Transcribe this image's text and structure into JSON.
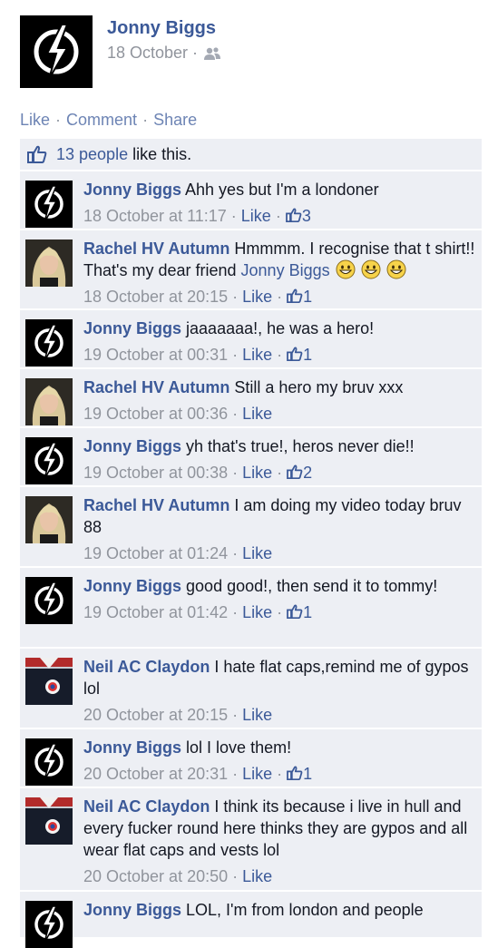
{
  "post": {
    "author": "Jonny Biggs",
    "date": "18 October ·",
    "audience_icon": "friends-icon"
  },
  "actions": {
    "like": "Like",
    "comment": "Comment",
    "share": "Share",
    "separator": "·"
  },
  "likes_summary": {
    "link_text": "13 people",
    "suffix": "like this."
  },
  "comments": [
    {
      "author": "Jonny Biggs",
      "avatar": "logo",
      "text": "Ahh yes but I'm a londoner",
      "time": "18 October at 11:17",
      "like": "Like",
      "likes": "3"
    },
    {
      "author": "Rachel HV Autumn",
      "avatar": "woman",
      "text": "Hmmmm. I recognise that t shirt!! That's my dear friend",
      "mention": "Jonny Biggs",
      "emoji_count": 3,
      "time": "18 October at 20:15",
      "like": "Like",
      "likes": "1"
    },
    {
      "author": "Jonny Biggs",
      "avatar": "logo",
      "text": "jaaaaaaa!, he was a hero!",
      "time": "19 October at 00:31",
      "like": "Like",
      "likes": "1"
    },
    {
      "author": "Rachel HV Autumn",
      "avatar": "woman",
      "text": "Still a hero my bruv xxx",
      "time": "19 October at 00:36",
      "like": "Like",
      "likes": ""
    },
    {
      "author": "Jonny Biggs",
      "avatar": "logo",
      "text": "yh that's true!, heros never die!!",
      "time": "19 October at 00:38",
      "like": "Like",
      "likes": "2"
    },
    {
      "author": "Rachel HV Autumn",
      "avatar": "woman",
      "text": "I am doing my video today bruv 88",
      "time": "19 October at 01:24",
      "like": "Like",
      "likes": ""
    },
    {
      "author": "Jonny Biggs",
      "avatar": "logo",
      "text": "good good!, then send it to tommy!",
      "time": "19 October at 01:42",
      "like": "Like",
      "likes": "1"
    },
    {
      "author": "Neil AC Claydon",
      "avatar": "shirt",
      "text": "I hate flat caps,remind me of gypos lol",
      "time": "20 October at 20:15",
      "like": "Like",
      "likes": ""
    },
    {
      "author": "Jonny Biggs",
      "avatar": "logo",
      "text": "lol I love them!",
      "time": "20 October at 20:31",
      "like": "Like",
      "likes": "1"
    },
    {
      "author": "Neil AC Claydon",
      "avatar": "shirt",
      "text": "I think its because i live in hull and every fucker round here thinks they are gypos and all wear flat caps and vests lol",
      "time": "20 October at 20:50",
      "like": "Like",
      "likes": ""
    },
    {
      "author": "Jonny Biggs",
      "avatar": "logo",
      "text": "LOL, I'm from london and people",
      "time": "",
      "like": "",
      "likes": ""
    }
  ],
  "colors": {
    "link": "#3b5998",
    "meta": "#90949c",
    "feed_bg": "#edeff4",
    "text": "#141823"
  }
}
